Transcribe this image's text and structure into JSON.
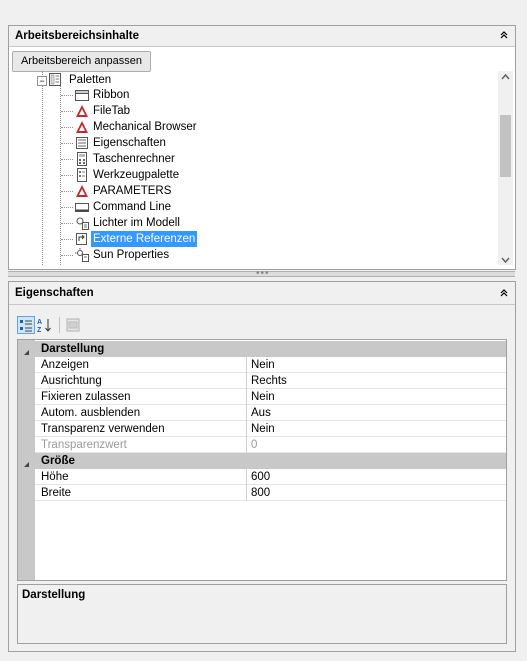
{
  "workspace_contents": {
    "title": "Arbeitsbereichsinhalte",
    "customize_button": "Arbeitsbereich anpassen",
    "root_label": "Paletten",
    "items": [
      {
        "label": "Ribbon",
        "icon": "ribbon-icon"
      },
      {
        "label": "FileTab",
        "icon": "autocad-icon"
      },
      {
        "label": "Mechanical Browser",
        "icon": "autocad-icon"
      },
      {
        "label": "Eigenschaften",
        "icon": "properties-icon"
      },
      {
        "label": "Taschenrechner",
        "icon": "calculator-icon"
      },
      {
        "label": "Werkzeugpalette",
        "icon": "tool-palette-icon"
      },
      {
        "label": "PARAMETERS",
        "icon": "autocad-icon"
      },
      {
        "label": "Command Line",
        "icon": "command-line-icon"
      },
      {
        "label": "Lichter im Modell",
        "icon": "lights-icon"
      },
      {
        "label": "Externe Referenzen",
        "icon": "xref-icon",
        "selected": true
      },
      {
        "label": "Sun Properties",
        "icon": "sun-properties-icon"
      }
    ]
  },
  "properties": {
    "title": "Eigenschaften",
    "toolbar": [
      "categorized-icon",
      "alphabetical-icon",
      "property-pages-icon"
    ],
    "categories": [
      {
        "name": "Darstellung",
        "rows": [
          {
            "key": "Anzeigen",
            "value": "Nein"
          },
          {
            "key": "Ausrichtung",
            "value": "Rechts"
          },
          {
            "key": "Fixieren zulassen",
            "value": "Nein"
          },
          {
            "key": "Autom. ausblenden",
            "value": "Aus"
          },
          {
            "key": "Transparenz verwenden",
            "value": "Nein"
          },
          {
            "key": "Transparenzwert",
            "value": "0",
            "disabled": true
          }
        ]
      },
      {
        "name": "Größe",
        "rows": [
          {
            "key": "Höhe",
            "value": "600"
          },
          {
            "key": "Breite",
            "value": "800"
          }
        ]
      }
    ],
    "description_title": "Darstellung"
  },
  "colors": {
    "selection": "#3399ff",
    "category_bg": "#c8c8c8",
    "autocad_red": "#c8272d"
  }
}
